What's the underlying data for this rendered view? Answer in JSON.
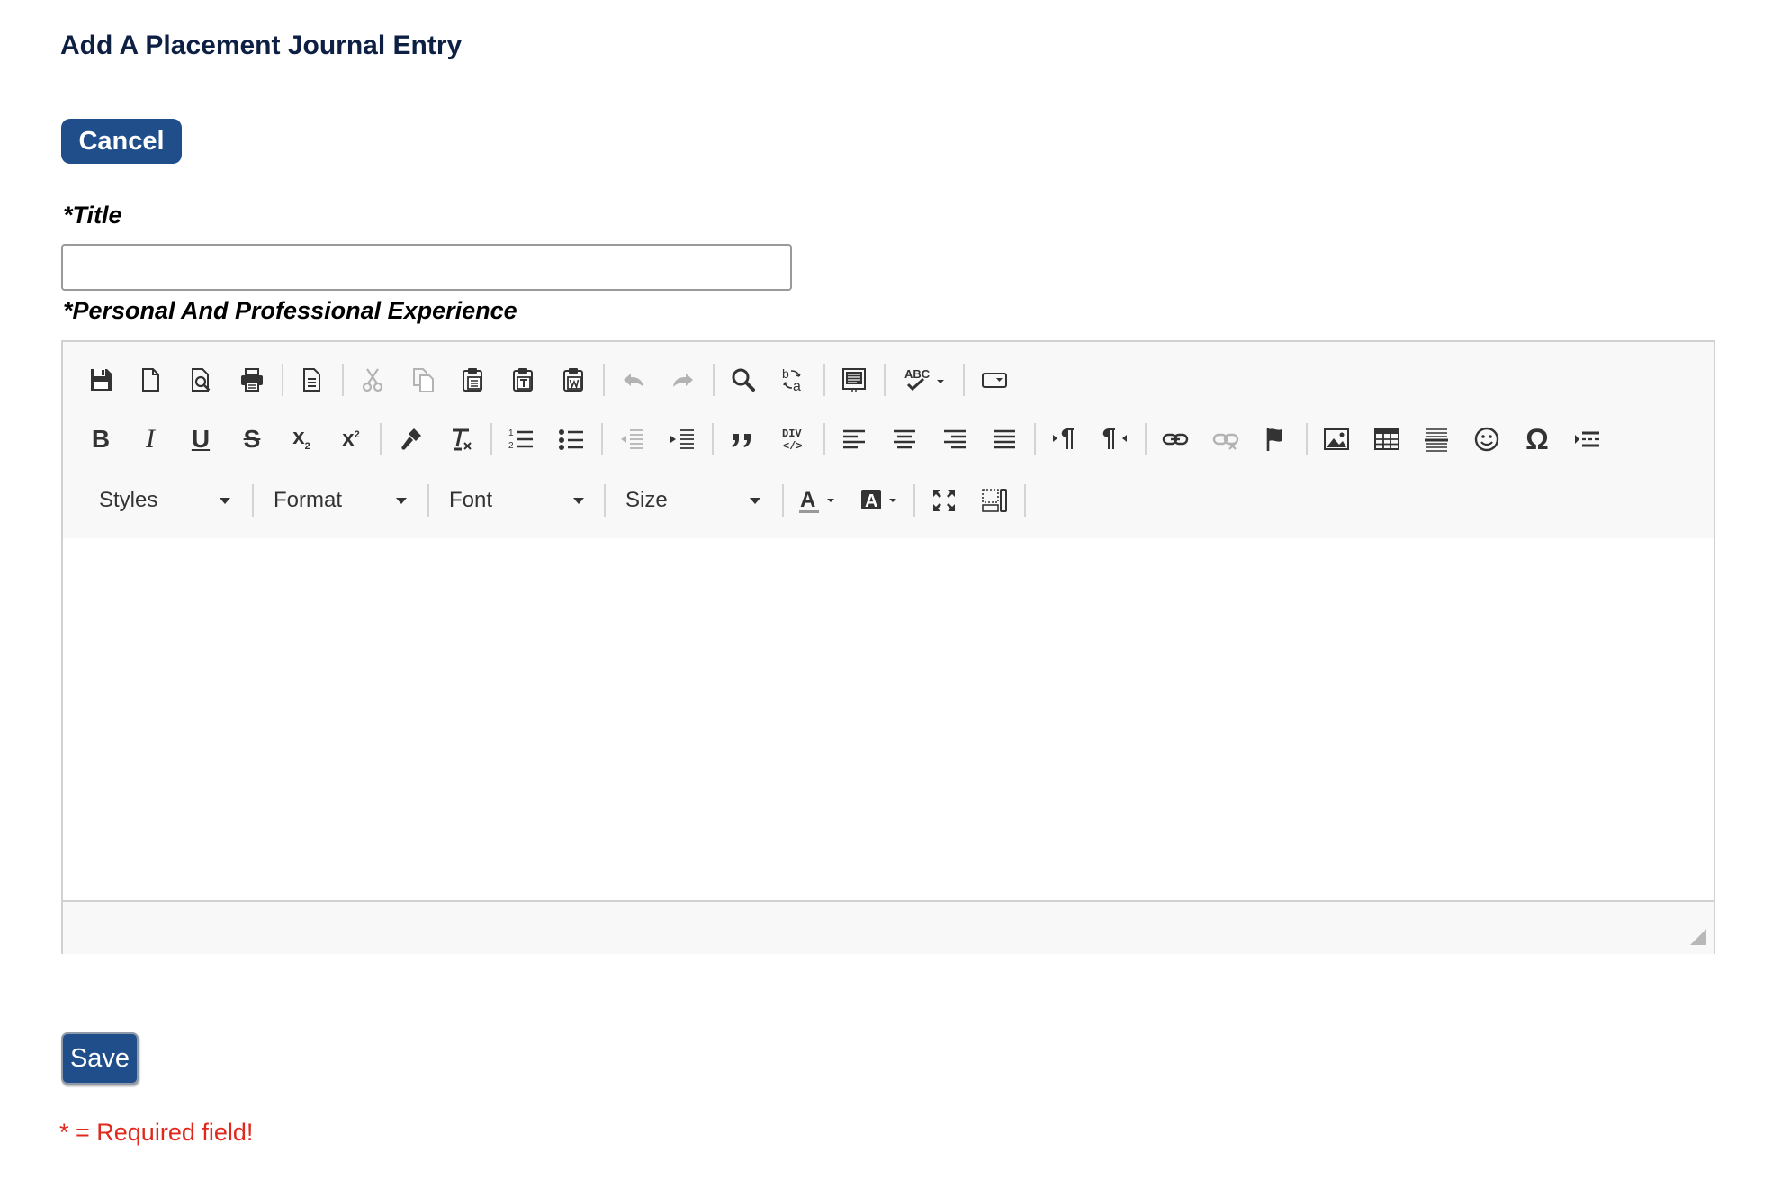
{
  "page": {
    "heading": "Add A Placement Journal Entry",
    "cancel_label": "Cancel",
    "save_label": "Save",
    "required_note": "* = Required field!"
  },
  "form": {
    "title_label": "*Title",
    "title_value": "",
    "experience_label": "*Personal And Professional Experience"
  },
  "editor": {
    "combos": {
      "styles": "Styles",
      "format": "Format",
      "font": "Font",
      "size": "Size"
    },
    "row1_icons": [
      "save-icon",
      "new-page-icon",
      "preview-icon",
      "print-icon",
      "templates-icon",
      "cut-icon",
      "copy-icon",
      "paste-icon",
      "paste-text-icon",
      "paste-word-icon",
      "undo-icon",
      "redo-icon",
      "find-icon",
      "replace-icon",
      "select-all-icon",
      "spellcheck-icon",
      "form-select-icon"
    ],
    "row2_icons": [
      "bold-icon",
      "italic-icon",
      "underline-icon",
      "strike-icon",
      "subscript-icon",
      "superscript-icon",
      "copy-format-icon",
      "remove-format-icon",
      "numbered-list-icon",
      "bulleted-list-icon",
      "outdent-icon",
      "indent-icon",
      "blockquote-icon",
      "create-div-icon",
      "align-left-icon",
      "align-center-icon",
      "align-right-icon",
      "justify-icon",
      "ltr-icon",
      "rtl-icon",
      "link-icon",
      "unlink-icon",
      "anchor-icon",
      "image-icon",
      "table-icon",
      "horizontal-rule-icon",
      "smiley-icon",
      "special-char-icon",
      "page-break-icon"
    ],
    "row3_icons": [
      "text-color-icon",
      "background-color-icon",
      "maximize-icon",
      "show-blocks-icon"
    ],
    "disabled_icons": [
      "cut-icon",
      "copy-icon",
      "undo-icon",
      "redo-icon",
      "outdent-icon",
      "unlink-icon"
    ],
    "colors": {
      "toolbar_bg": "#f8f8f8",
      "icon": "#333333",
      "icon_disabled": "#b3b3b3",
      "border": "#d1d1d1"
    }
  },
  "colors": {
    "heading": "#0e1f44",
    "button_bg": "#1f4e8b",
    "required": "#e0281c"
  }
}
